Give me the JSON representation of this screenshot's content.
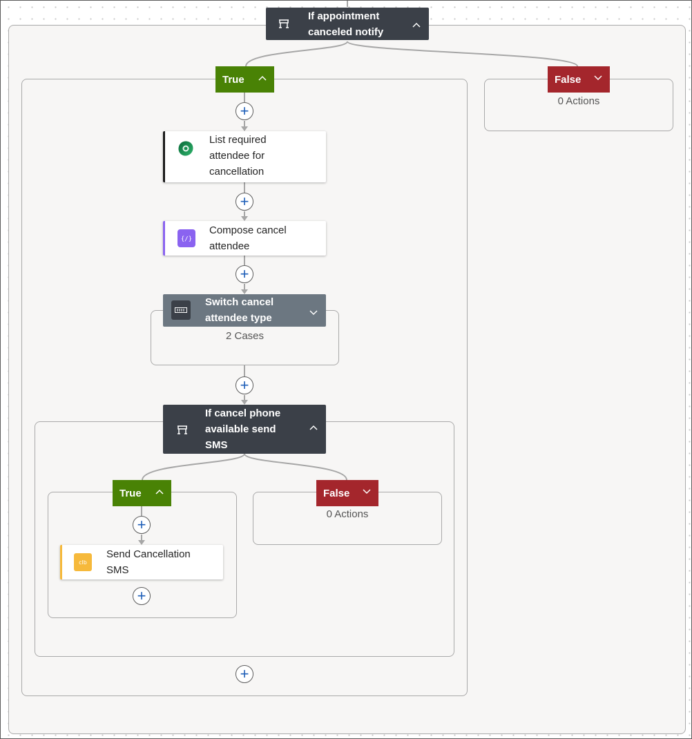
{
  "outer_condition": {
    "title_line1": "If appointment",
    "title_line2": "canceled notify",
    "icon": "condition-icon",
    "chevron": "chevron-up-icon"
  },
  "outer_true": {
    "label": "True",
    "chevron": "chevron-up-icon",
    "actions": [
      {
        "title_line1": "List required",
        "title_line2": "attendee for",
        "title_line3": "cancellation",
        "icon": "dataverse-icon"
      },
      {
        "title_line1": "Compose cancel",
        "title_line2": "attendee",
        "icon": "compose-icon"
      }
    ],
    "switch": {
      "title_line1": "Switch cancel",
      "title_line2": "attendee type",
      "cases": "2 Cases",
      "icon": "switch-icon",
      "chevron": "chevron-down-icon"
    },
    "inner_condition": {
      "title_line1": "If cancel phone",
      "title_line2": "available send",
      "title_line3": "SMS",
      "icon": "condition-icon",
      "chevron": "chevron-up-icon",
      "true_branch": {
        "label": "True",
        "chevron": "chevron-up-icon",
        "action": {
          "title_line1": "Send Cancellation",
          "title_line2": "SMS",
          "icon": "sms-icon"
        }
      },
      "false_branch": {
        "label": "False",
        "chevron": "chevron-down-icon",
        "count": "0 Actions"
      }
    }
  },
  "outer_false": {
    "label": "False",
    "chevron": "chevron-down-icon",
    "count": "0 Actions"
  },
  "plus_symbol": "+",
  "colors": {
    "condition_header": "#3b4048",
    "switch_header": "#6c7781",
    "true_badge": "#498205",
    "false_badge": "#a4262c",
    "dataverse_accent": "#1a1a1a",
    "compose_accent": "#8a63f0",
    "sms_accent": "#f6b93b",
    "plus_icon": "#1f5fb8"
  }
}
